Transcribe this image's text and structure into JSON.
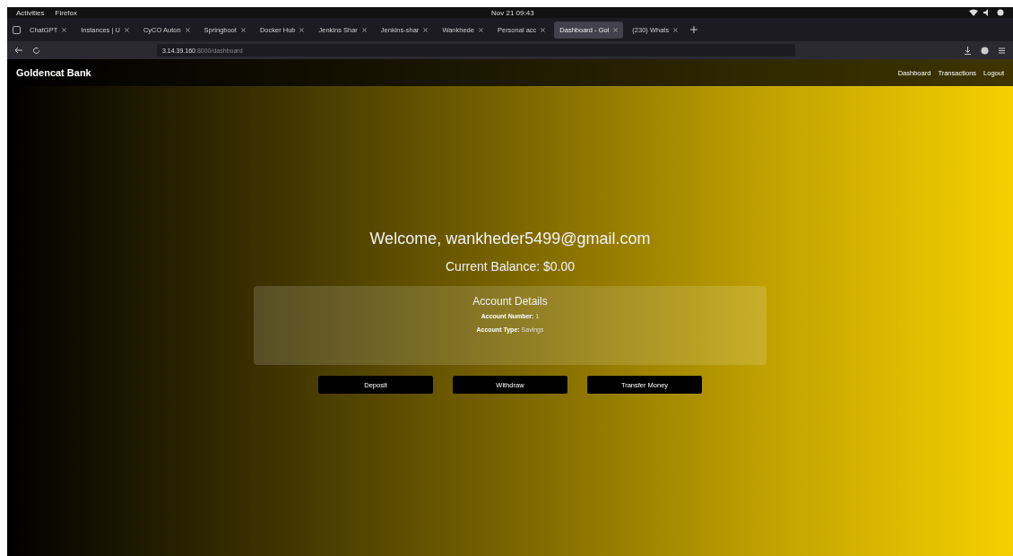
{
  "top_bar": {
    "activities": "Activities",
    "app": "Firefox",
    "clock": "Nov 21  09:43"
  },
  "tabs": [
    {
      "label": "ChatGPT",
      "selected": false
    },
    {
      "label": "Instances | U",
      "selected": false
    },
    {
      "label": "CyCO Auton",
      "selected": false
    },
    {
      "label": "Springboot",
      "selected": false
    },
    {
      "label": "Docker Hub",
      "selected": false
    },
    {
      "label": "Jenkins Shar",
      "selected": false
    },
    {
      "label": "Jenkins-shar",
      "selected": false
    },
    {
      "label": "Wankhede",
      "selected": false
    },
    {
      "label": "Personal acc",
      "selected": false
    },
    {
      "label": "Dashboard - Gol",
      "selected": true
    },
    {
      "label": "(230) Whats",
      "selected": false
    }
  ],
  "address_bar": {
    "host": "3.14.39.160",
    "path": ":8000/dashboard"
  },
  "site_nav": {
    "brand": "Goldencat Bank",
    "links": [
      "Dashboard",
      "Transactions",
      "Logout"
    ]
  },
  "welcome": "Welcome, wankheder5499@gmail.com",
  "balance": "Current Balance: $0.00",
  "account_details": {
    "title": "Account Details",
    "fields": [
      {
        "label": "Account Number:",
        "value": "1"
      },
      {
        "label": "Account Type:",
        "value": "Savings"
      }
    ]
  },
  "buttons": [
    "Deposit",
    "Withdraw",
    "Transfer Money"
  ]
}
